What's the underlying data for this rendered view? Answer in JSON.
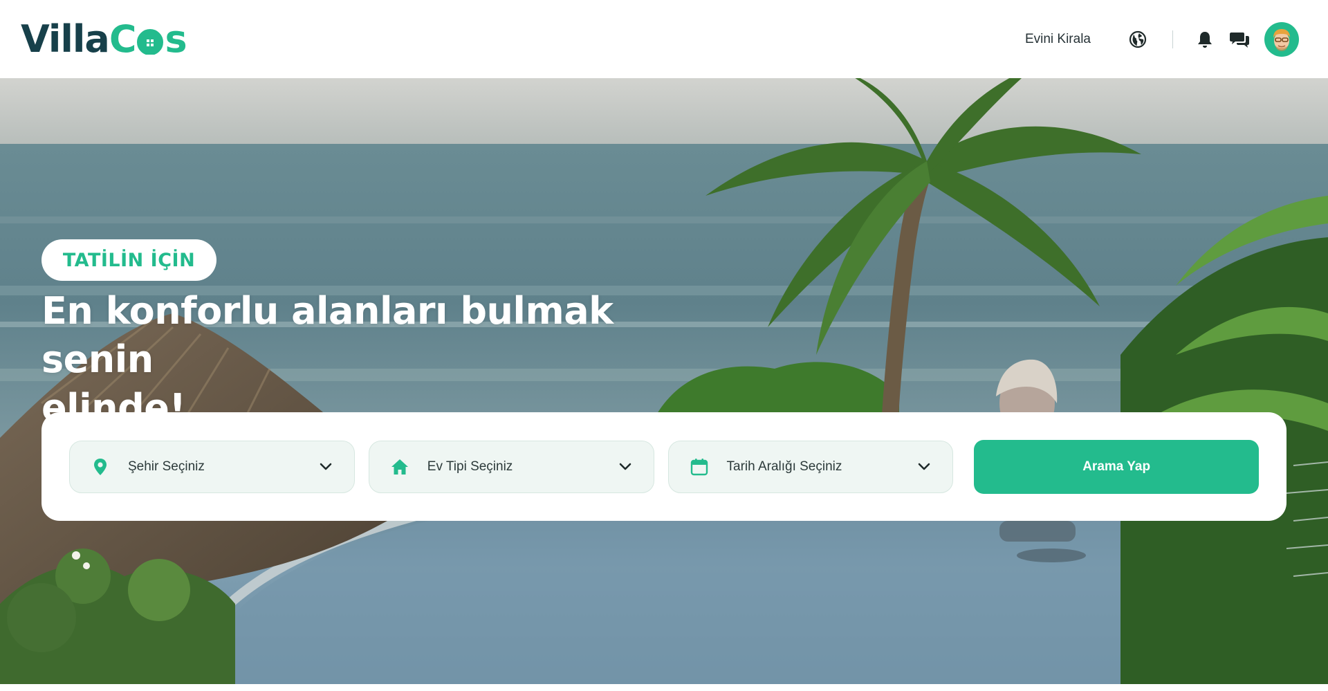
{
  "brand": {
    "name_part1": "Villa",
    "name_part2_c": "C",
    "name_part2_s": "s",
    "primary_color": "#23bb8d",
    "dark_color": "#17404a"
  },
  "header": {
    "rent_link": "Evini Kirala",
    "icons": [
      "globe-icon",
      "bell-icon",
      "chat-icon",
      "avatar"
    ]
  },
  "hero": {
    "tag": "TATİLİN İÇİN",
    "headline_line1": "En konforlu alanları bulmak senin",
    "headline_line2": "elinde!"
  },
  "search": {
    "city": {
      "label": "Şehir Seçiniz",
      "icon": "location-pin-icon"
    },
    "house_type": {
      "label": "Ev Tipi Seçiniz",
      "icon": "house-icon"
    },
    "date_range": {
      "label": "Tarih Aralığı Seçiniz",
      "icon": "calendar-icon"
    },
    "submit_label": "Arama Yap"
  }
}
